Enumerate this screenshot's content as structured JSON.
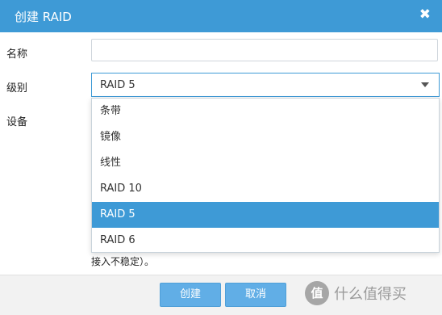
{
  "dialog": {
    "title": "创建 RAID",
    "close_icon": "✖"
  },
  "form": {
    "name_label": "名称",
    "name_value": "",
    "level_label": "级别",
    "level_value": "RAID 5",
    "device_label": "设备"
  },
  "dropdown": {
    "options": [
      "条带",
      "镜像",
      "线性",
      "RAID 10",
      "RAID 5",
      "RAID 6"
    ],
    "selected_index": 4
  },
  "note": "接入不稳定）。",
  "footer": {
    "create_label": "创建",
    "cancel_label": "取消"
  },
  "watermark": {
    "badge": "值",
    "text": "什么值得买"
  },
  "colors": {
    "accent": "#3e9ad6",
    "button": "#61aee6"
  }
}
